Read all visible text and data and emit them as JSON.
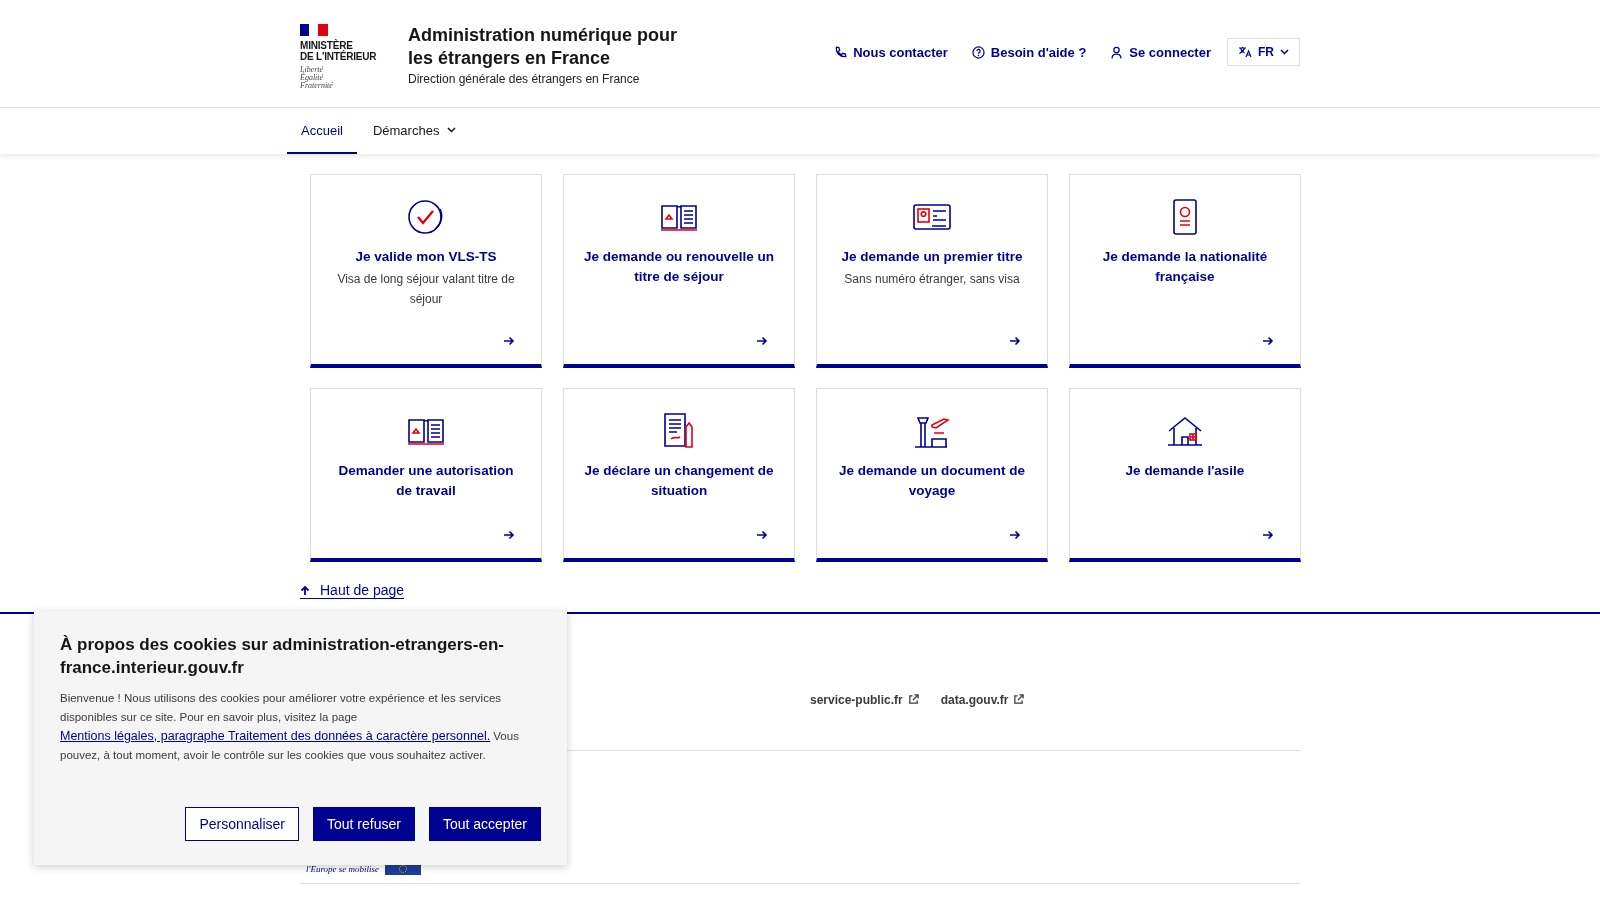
{
  "header": {
    "logo": {
      "lines": [
        "MINISTÈRE",
        "DE L'INTÉRIEUR"
      ],
      "motto": [
        "Liberté",
        "Égalité",
        "Fraternité"
      ]
    },
    "title": "Administration numérique pour les étrangers en France",
    "subtitle": "Direction générale des étrangers en France",
    "links": [
      {
        "label": "Nous contacter"
      },
      {
        "label": "Besoin d'aide ?"
      },
      {
        "label": "Se connecter"
      }
    ],
    "language": "FR"
  },
  "nav": [
    {
      "label": "Accueil",
      "selected": true,
      "dropdown": false
    },
    {
      "label": "Démarches",
      "selected": false,
      "dropdown": true
    }
  ],
  "cards": [
    {
      "title": "Je valide mon VLS-TS",
      "description": "Visa de long séjour valant titre de séjour"
    },
    {
      "title": "Je demande ou renouvelle un titre de séjour"
    },
    {
      "title": "Je demande un premier titre",
      "description": "Sans numéro étranger, sans visa"
    },
    {
      "title": "Je demande la nationalité française"
    },
    {
      "title": "Demander une autorisation de travail"
    },
    {
      "title": "Je déclare un changement de situation"
    },
    {
      "title": "Je demande un document de voyage"
    },
    {
      "title": "Je demande l'asile"
    }
  ],
  "back_to_top": "Haut de page",
  "footer": {
    "links": [
      "service-public.fr",
      "data.gouv.fr"
    ],
    "eu_text": "l'Europe se mobilise"
  },
  "cookie_banner": {
    "title": "À propos des cookies sur administration-etrangers-en-france.interieur.gouv.fr",
    "text_before": "Bienvenue ! Nous utilisons des cookies pour améliorer votre expérience et les services disponibles sur ce site. Pour en savoir plus, visitez la page",
    "link": "Mentions légales, paragraphe Traitement des données à caractère personnel.",
    "text_after": "Vous pouvez, à tout moment, avoir le contrôle sur les cookies que vous souhaitez activer.",
    "buttons": [
      {
        "label": "Personnaliser",
        "kind": "secondary"
      },
      {
        "label": "Tout refuser",
        "kind": "primary"
      },
      {
        "label": "Tout accepter",
        "kind": "primary"
      }
    ]
  }
}
